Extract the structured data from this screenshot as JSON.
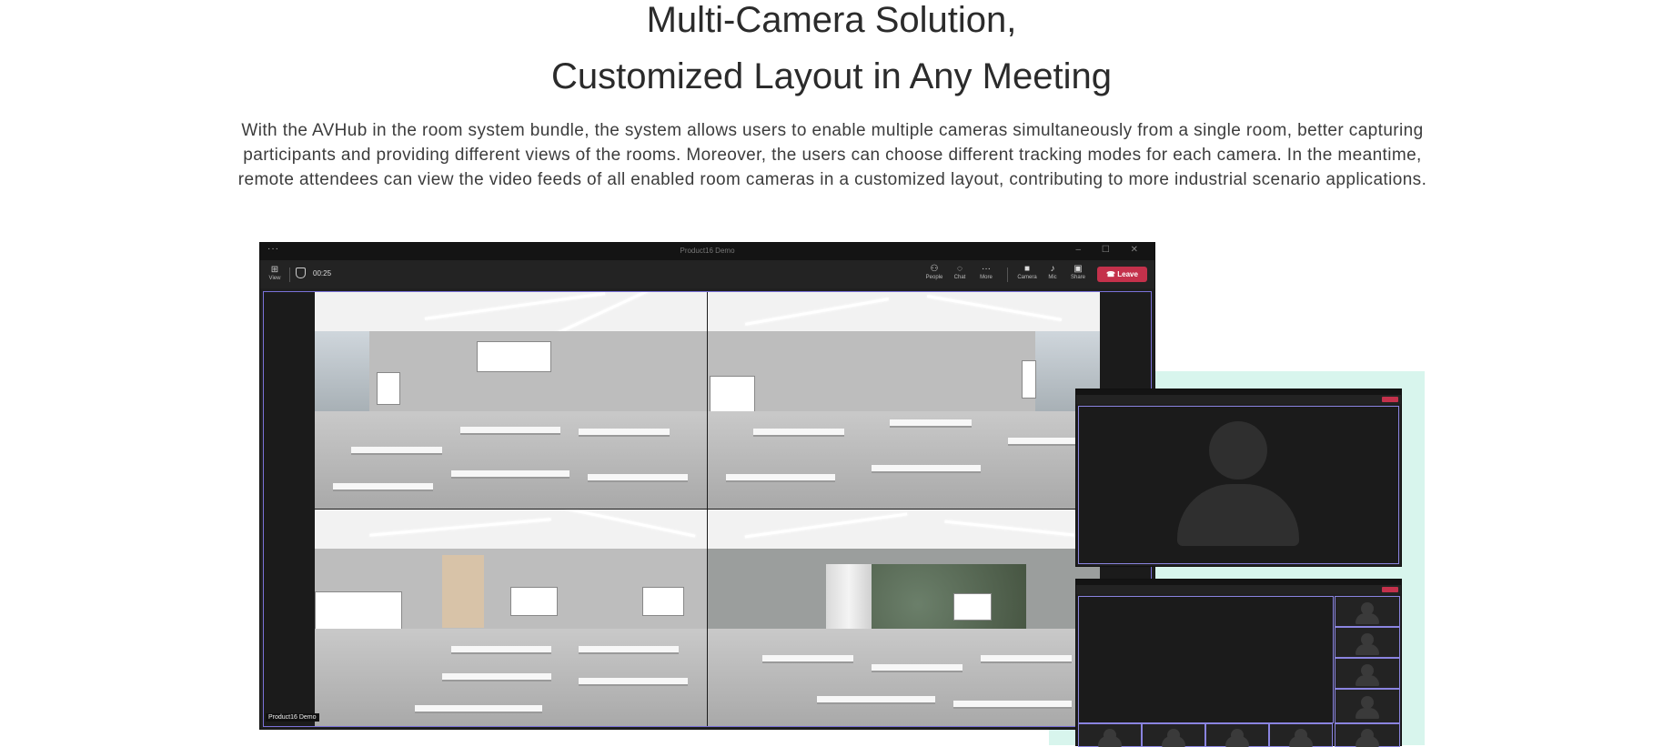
{
  "heading": {
    "line1": "Multi-Camera Solution,",
    "line2": "Customized Layout in Any Meeting"
  },
  "description": {
    "line1": "With the AVHub in the room system bundle, the system allows users to enable multiple cameras simultaneously from a single room, better capturing",
    "line2": "participants and providing different views of the rooms. Moreover, the users can choose different tracking modes for each camera. In the meantime,",
    "line3": "remote attendees can view the video feeds of all enabled room cameras in a customized layout, contributing to more industrial scenario applications."
  },
  "meeting_window": {
    "menu_dots": "···",
    "title": "Product16 Demo",
    "window_controls": "– ☐ ✕",
    "view_label": "View",
    "timer": "00:25",
    "toolbar": {
      "people": "People",
      "chat": "Chat",
      "more": "More",
      "camera": "Camera",
      "mic": "Mic",
      "share": "Share",
      "leave": "Leave"
    },
    "name_tag": "Product16 Demo"
  },
  "colors": {
    "leave_button": "#c4314b",
    "active_border": "#7a72d9",
    "mint_background": "#d8f5ed",
    "window_dark": "#1f1f1f"
  },
  "icons": {
    "view": "grid-icon",
    "shield": "shield-icon",
    "people": "people-icon",
    "chat": "chat-icon",
    "more": "more-icon",
    "camera": "camera-icon",
    "mic": "mic-icon",
    "share": "share-icon",
    "leave": "phone-hangup-icon"
  }
}
